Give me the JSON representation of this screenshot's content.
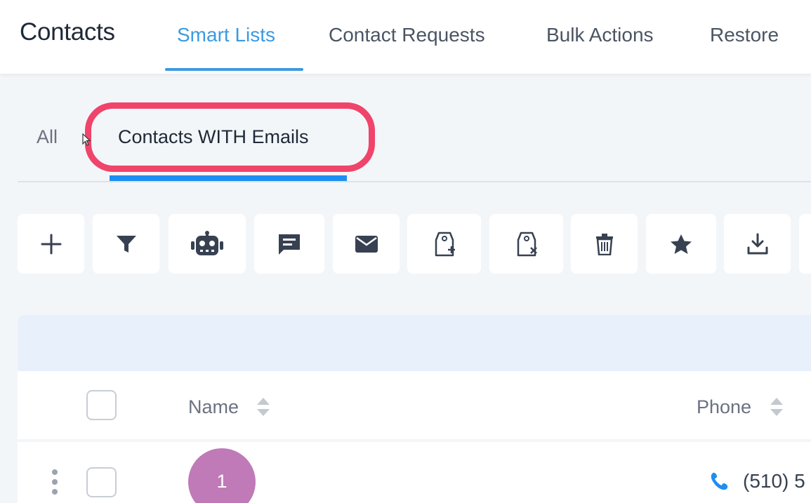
{
  "header": {
    "title": "Contacts",
    "tabs": [
      {
        "label": "Smart Lists",
        "active": true
      },
      {
        "label": "Contact Requests",
        "active": false
      },
      {
        "label": "Bulk Actions",
        "active": false
      },
      {
        "label": "Restore",
        "active": false
      }
    ]
  },
  "smart_lists": {
    "tabs": [
      {
        "label": "All",
        "active": false
      },
      {
        "label": "Contacts WITH Emails",
        "active": true
      }
    ]
  },
  "toolbar": {
    "buttons": [
      {
        "icon": "plus-icon"
      },
      {
        "icon": "filter-icon"
      },
      {
        "icon": "robot-icon"
      },
      {
        "icon": "message-icon"
      },
      {
        "icon": "envelope-icon"
      },
      {
        "icon": "add-tag-icon"
      },
      {
        "icon": "remove-tag-icon"
      },
      {
        "icon": "trash-icon"
      },
      {
        "icon": "star-icon"
      },
      {
        "icon": "download-icon"
      }
    ]
  },
  "table": {
    "columns": [
      {
        "label": "Name"
      },
      {
        "label": "Phone"
      }
    ],
    "rows": [
      {
        "avatar_text": "1",
        "phone": "(510) 5"
      }
    ]
  },
  "colors": {
    "accent": "#3b9ae1",
    "tab_underline": "#1d8ef2",
    "highlight": "#f0446b",
    "avatar": "#c07ab8",
    "phone_icon": "#1d8ef2"
  }
}
